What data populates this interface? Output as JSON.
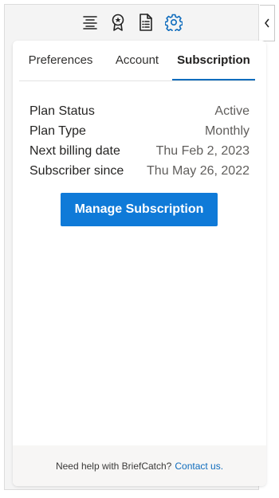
{
  "toolbar": {
    "icons": [
      "summary-icon",
      "award-icon",
      "document-icon",
      "settings-icon"
    ],
    "active_color": "#0f6cbd"
  },
  "collapse": {
    "glyph": "‹"
  },
  "tabs": [
    {
      "label": "Preferences",
      "active": false
    },
    {
      "label": "Account",
      "active": false
    },
    {
      "label": "Subscription",
      "active": true
    }
  ],
  "subscription": {
    "rows": [
      {
        "label": "Plan Status",
        "value": "Active"
      },
      {
        "label": "Plan Type",
        "value": "Monthly"
      },
      {
        "label": "Next billing date",
        "value": "Thu Feb 2, 2023"
      },
      {
        "label": "Subscriber since",
        "value": "Thu May 26, 2022"
      }
    ],
    "manage_label": "Manage Subscription"
  },
  "footer": {
    "text": "Need help with BriefCatch?",
    "link_text": "Contact us.",
    "link_color": "#0f6cbd"
  },
  "colors": {
    "primary_button": "#0f7ad8",
    "tab_indicator": "#0f6cbd"
  }
}
